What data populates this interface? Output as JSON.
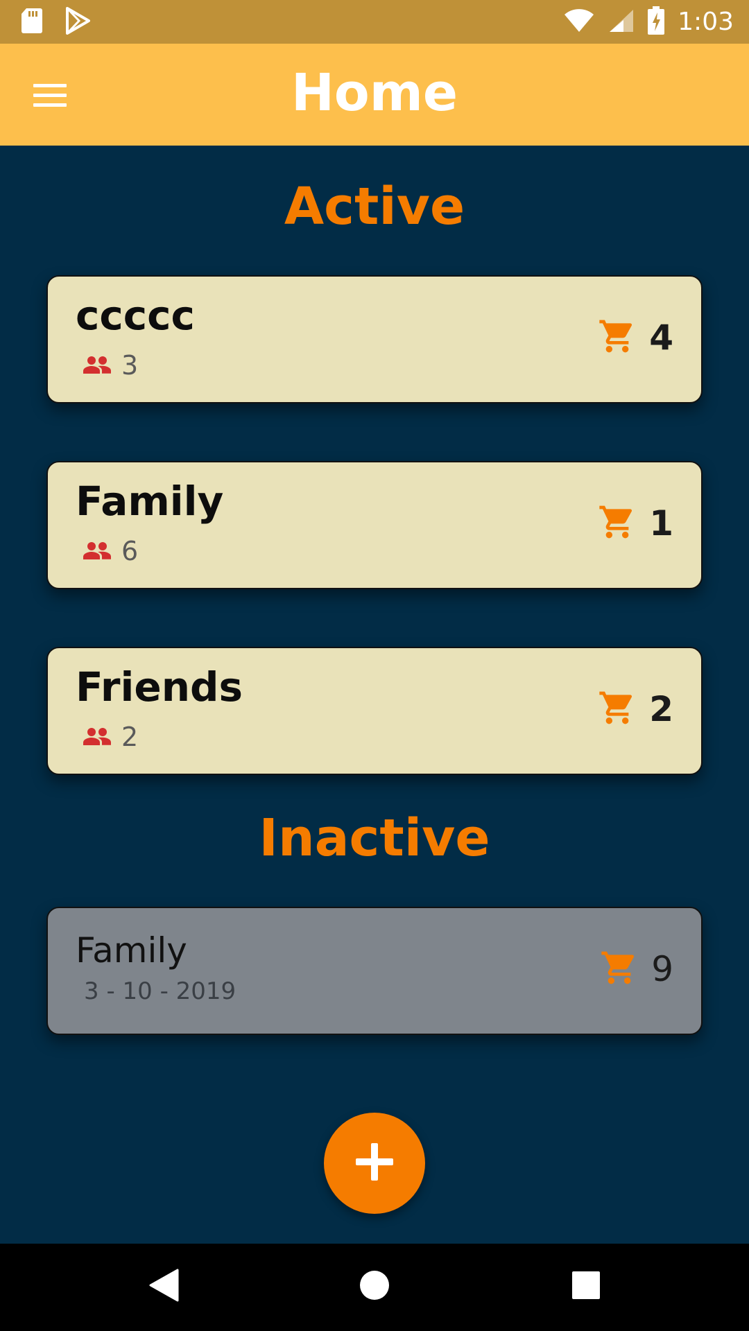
{
  "status_bar": {
    "time": "1:03",
    "icons": [
      "sd-card-icon",
      "play-store-icon",
      "wifi-icon",
      "signal-icon",
      "battery-charging-icon"
    ]
  },
  "app_bar": {
    "title": "Home",
    "menu_icon": "menu-icon"
  },
  "sections": {
    "active_title": "Active",
    "inactive_title": "Inactive"
  },
  "active_lists": [
    {
      "name": "ccccc",
      "members": "3",
      "items": "4"
    },
    {
      "name": "Family",
      "members": "6",
      "items": "1"
    },
    {
      "name": "Friends",
      "members": "2",
      "items": "2"
    }
  ],
  "inactive_lists": [
    {
      "name": "Family",
      "date": "3 - 10 - 2019",
      "items": "9"
    }
  ],
  "colors": {
    "status_bar": "#bf9138",
    "app_bar": "#fdbf4c",
    "background": "#022c46",
    "accent": "#f57c00",
    "active_card": "#e9e2b9",
    "inactive_card": "#7f858c",
    "members_icon": "#d32f2f"
  },
  "fab_icon": "add-icon",
  "nav": [
    "back-icon",
    "home-icon",
    "recents-icon"
  ]
}
